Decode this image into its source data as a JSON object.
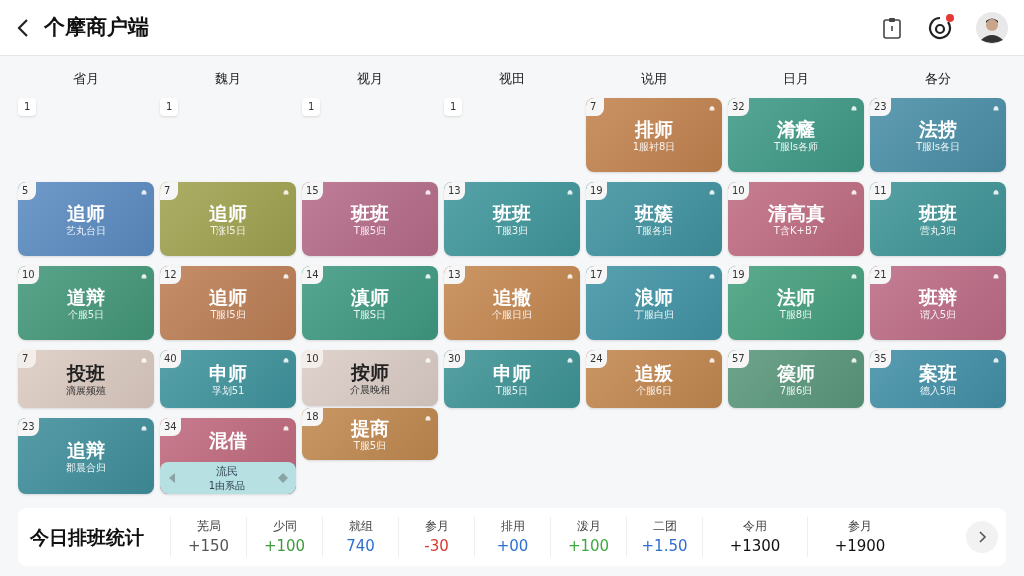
{
  "header": {
    "title": "个摩商户端",
    "notification_dot": true
  },
  "day_headers": [
    "省月",
    "魏月",
    "视月",
    "视田",
    "说用",
    "日月",
    "各分"
  ],
  "rows": [
    [
      {
        "kind": "empty",
        "date": "1"
      },
      {
        "kind": "empty",
        "date": "1"
      },
      {
        "kind": "empty",
        "date": "1"
      },
      {
        "kind": "empty",
        "date": "1"
      },
      {
        "kind": "shift",
        "date": "7",
        "title": "排师",
        "sub": "1服衬8日",
        "color": "#c3834f"
      },
      {
        "kind": "shift",
        "date": "32",
        "title": "淆癃",
        "sub": "T服ls各师",
        "color": "#3f9a86"
      },
      {
        "kind": "shift",
        "date": "23",
        "title": "法捞",
        "sub": "T服ls各日",
        "color": "#4a8fa8"
      }
    ],
    [
      {
        "kind": "shift",
        "date": "5",
        "title": "追师",
        "sub": "艺丸台日",
        "color": "#5b8cc2"
      },
      {
        "kind": "shift",
        "date": "7",
        "title": "追师",
        "sub": "T涨l5日",
        "color": "#a0a350"
      },
      {
        "kind": "shift",
        "date": "15",
        "title": "班班",
        "sub": "T服5归",
        "color": "#b76c8a"
      },
      {
        "kind": "shift",
        "date": "13",
        "title": "班班",
        "sub": "T服3归",
        "color": "#3f979c"
      },
      {
        "kind": "shift",
        "date": "19",
        "title": "班簇",
        "sub": "T服各归",
        "color": "#3f93a0"
      },
      {
        "kind": "shift",
        "date": "10",
        "title": "清高真",
        "sub": "T含K+B7",
        "color": "#c06c82"
      },
      {
        "kind": "shift",
        "date": "11",
        "title": "班班",
        "sub": "营丸3归",
        "color": "#3f9598"
      }
    ],
    [
      {
        "kind": "shift",
        "date": "10",
        "title": "道辩",
        "sub": "个服5日",
        "color": "#43987a"
      },
      {
        "kind": "shift",
        "date": "12",
        "title": "追师",
        "sub": "T服l5归",
        "color": "#bd7f55"
      },
      {
        "kind": "shift",
        "date": "14",
        "title": "滇师",
        "sub": "T服S日",
        "color": "#3f9a82"
      },
      {
        "kind": "shift",
        "date": "13",
        "title": "追撤",
        "sub": "个服日归",
        "color": "#c58850"
      },
      {
        "kind": "shift",
        "date": "17",
        "title": "浪师",
        "sub": "丁服白归",
        "color": "#4194a6"
      },
      {
        "kind": "shift",
        "date": "19",
        "title": "法师",
        "sub": "T服8归",
        "color": "#45a07e"
      },
      {
        "kind": "shift",
        "date": "21",
        "title": "班辩",
        "sub": "谓入5归",
        "color": "#bd6c86"
      }
    ],
    [
      {
        "kind": "light_shift",
        "date": "7",
        "title": "投班",
        "sub": "滴展频殖",
        "color": "#dccbc2"
      },
      {
        "kind": "shift",
        "date": "40",
        "title": "申师",
        "sub": "孚划51",
        "color": "#3f949e"
      },
      {
        "kind": "stack",
        "cards": [
          {
            "kind": "light_shift",
            "date": "10",
            "title": "按师",
            "sub": "介晨晚相",
            "color": "#dccdc6"
          },
          {
            "kind": "shift",
            "date": "18",
            "title": "提商",
            "sub": "T服5归",
            "color": "#c1894f"
          }
        ]
      },
      {
        "kind": "shift",
        "date": "30",
        "title": "申师",
        "sub": "T服5日",
        "color": "#3e9496"
      },
      {
        "kind": "shift",
        "date": "24",
        "title": "追叛",
        "sub": "个服6日",
        "color": "#c3884f"
      },
      {
        "kind": "shift",
        "date": "57",
        "title": "篌师",
        "sub": "7服6归",
        "color": "#5a987c"
      },
      {
        "kind": "shift",
        "date": "35",
        "title": "案班",
        "sub": "德入5归",
        "color": "#4290a8"
      }
    ],
    [
      {
        "kind": "shift",
        "date": "23",
        "title": "追辩",
        "sub": "郡晨合归",
        "color": "#3f8f9c"
      },
      {
        "kind": "shift",
        "date": "34",
        "title": "混借",
        "color": "#c0697e",
        "popup": {
          "title": "流民",
          "sub": "1由系品"
        }
      }
    ]
  ],
  "stats": {
    "title": "今日排班统计",
    "items": [
      {
        "label": "芜局",
        "value": "+150",
        "color": "#555555"
      },
      {
        "label": "少同",
        "value": "+100",
        "color": "#3f9a3f"
      },
      {
        "label": "就组",
        "value": "740",
        "color": "#2f6fd0"
      },
      {
        "label": "参月",
        "value": "-30",
        "color": "#d83a30"
      },
      {
        "label": "排用",
        "value": "+00",
        "color": "#2f6fd0"
      },
      {
        "label": "泼月",
        "value": "+100",
        "color": "#3fa83f"
      },
      {
        "label": "二团",
        "value": "+1.50",
        "color": "#2f6fd0"
      },
      {
        "label": "令用",
        "value": "+1300",
        "color": "#111111"
      },
      {
        "label": "参月",
        "value": "+1900",
        "color": "#111111"
      }
    ]
  }
}
